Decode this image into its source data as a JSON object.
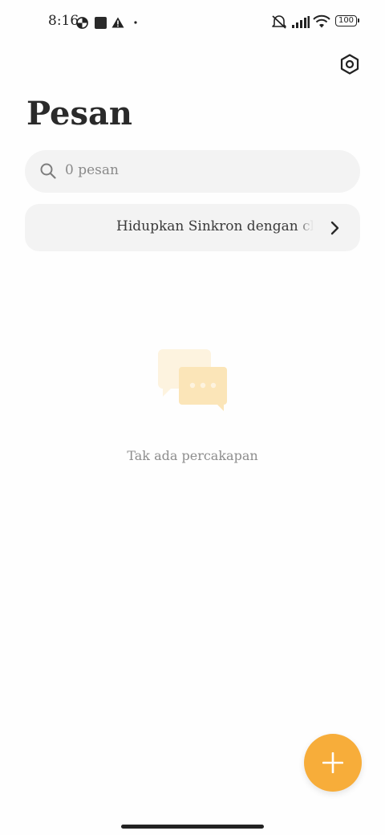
{
  "status_bar": {
    "time": "8:16",
    "battery": "100",
    "icons": [
      "data-saver-icon",
      "stop-square-icon",
      "warning-icon",
      "dot-icon",
      "mute-icon",
      "signal-icon",
      "wifi-icon",
      "battery-icon"
    ]
  },
  "header": {
    "title": "Pesan",
    "settings_icon": "gear-icon"
  },
  "search": {
    "placeholder": "0 pesan",
    "icon": "search-icon"
  },
  "sync_banner": {
    "text": "Hidupkan Sinkron dengan cloud",
    "icon": "chevron-right-icon"
  },
  "empty_state": {
    "text": "Tak ada percakapan",
    "icon": "chat-bubbles-icon"
  },
  "fab": {
    "icon": "plus-icon"
  },
  "colors": {
    "accent": "#f7ad3a",
    "surface": "#f3f3f3",
    "illustration_light": "#fdf3df",
    "illustration_mid": "#fbe5b8"
  }
}
